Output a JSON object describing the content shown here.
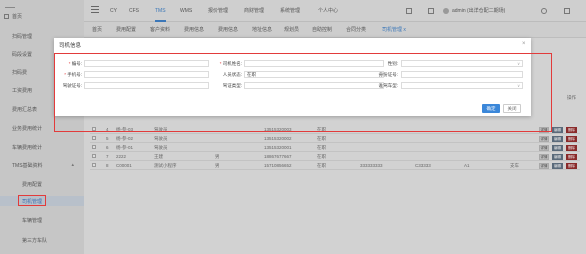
{
  "sidebar": {
    "home": "首页",
    "items": [
      {
        "label": "扫码管理"
      },
      {
        "label": "码段设置"
      },
      {
        "label": "扫码费"
      },
      {
        "label": "工资费用"
      },
      {
        "label": "费用汇总表"
      },
      {
        "label": "业务费用统计"
      },
      {
        "label": "车辆费用统计"
      },
      {
        "label": "TMS基础资料"
      },
      {
        "label": "费用配置"
      },
      {
        "label": "司机管理"
      },
      {
        "label": "车辆管理"
      },
      {
        "label": "第三方车队"
      }
    ]
  },
  "topnav": [
    "CY",
    "CFS",
    "TMS",
    "WMS",
    "报价管理",
    "商财管理",
    "系统管理",
    "个人中心"
  ],
  "user": {
    "label": "admin (出洋仓配二期场)"
  },
  "tabs": [
    "首页",
    "费用配置",
    "客户资料",
    "费用信息",
    "费用信息",
    "地址信息",
    "规划员",
    "自助控制",
    "合同分类",
    "司机管理 x"
  ],
  "table": {
    "ops_header": "操作",
    "rows": [
      {
        "idx": "4",
        "name": "杨-参-03",
        "type": "驾驶员",
        "phone": "13515320003",
        "status": "在职"
      },
      {
        "idx": "5",
        "name": "杨-参-02",
        "type": "驾驶员",
        "phone": "13515320002",
        "status": "在职"
      },
      {
        "idx": "6",
        "name": "杨-参-01",
        "type": "驾驶员",
        "phone": "13515320001",
        "status": "在职"
      },
      {
        "idx": "7",
        "name": "2222",
        "type": "王建",
        "gender": "男",
        "phone": "18867677667",
        "status": "在职"
      },
      {
        "idx": "8",
        "name": "C00001",
        "type": "测试小程序",
        "gender": "男",
        "phone": "15710856652",
        "status": "在职",
        "id": "333333333",
        "lic": "C33333",
        "lic_type": "A1",
        "vehicle": "支车"
      }
    ],
    "btn_view": "详情",
    "btn_edit": "编辑",
    "btn_del": "删除"
  },
  "modal": {
    "title": "司机信息",
    "close": "×",
    "fields": {
      "code": {
        "label": "编号:",
        "value": ""
      },
      "name": {
        "label": "司机姓名:",
        "value": ""
      },
      "gender": {
        "label": "性别:",
        "value": ""
      },
      "phone": {
        "label": "手机号:",
        "value": ""
      },
      "status": {
        "label": "人员状态:",
        "value": "在职"
      },
      "idcard": {
        "label": "身份证号:",
        "value": ""
      },
      "license_no": {
        "label": "驾驶证号:",
        "value": ""
      },
      "license_type": {
        "label": "驾证类型:",
        "value": ""
      },
      "quasi_type": {
        "label": "准驾车型:",
        "value": ""
      }
    },
    "ok": "确定",
    "cancel": "关闭"
  }
}
